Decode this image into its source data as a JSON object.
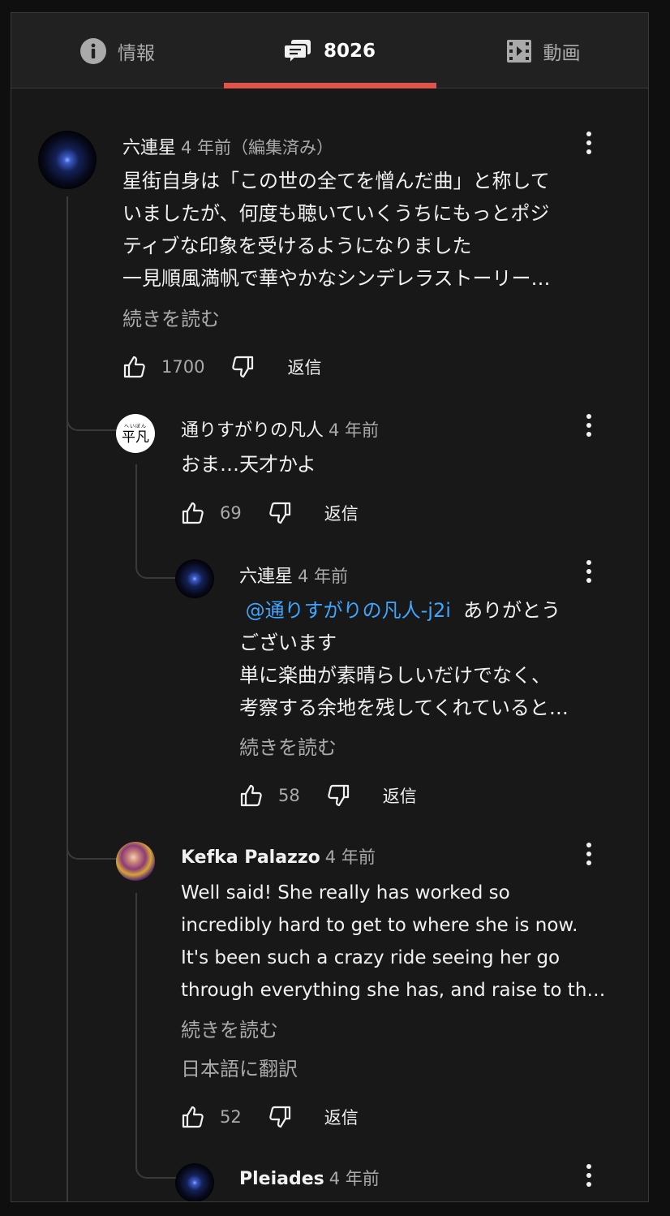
{
  "tabs": {
    "info_label": "情報",
    "comments_count": "8026",
    "video_label": "動画"
  },
  "comments": [
    {
      "author": "六連星",
      "time": "4 年前（編集済み）",
      "lines": [
        "星街自身は「この世の全てを憎んだ曲」と称して",
        "いましたが、何度も聴いていくうちにもっとポジ",
        "ティブな印象を受けるようになりました",
        "一見順風満帆で華やかなシンデレラストーリー…"
      ],
      "read_more": "続きを読む",
      "likes": "1700",
      "reply_label": "返信"
    },
    {
      "author": "通りすがりの凡人",
      "time": "4 年前",
      "avatar_text_small": "へいぼん",
      "avatar_text_big": "平凡",
      "lines": [
        "おま…天才かよ"
      ],
      "likes": "69",
      "reply_label": "返信"
    },
    {
      "author": "六連星",
      "time": "4 年前",
      "mention": "@通りすがりの凡人-j2i",
      "first_line_rest": "ありがとう",
      "lines": [
        "ございます",
        "単に楽曲が素晴らしいだけでなく、",
        "考察する余地を残してくれていると…"
      ],
      "read_more": "続きを読む",
      "likes": "58",
      "reply_label": "返信"
    },
    {
      "author": "Kefka Palazzo",
      "time": "4 年前",
      "lines": [
        "Well said! She really has worked so",
        "incredibly hard to get to where she is now.",
        "It's been such a crazy ride seeing her go",
        "through everything she has, and raise to th…"
      ],
      "read_more": "続きを読む",
      "translate": "日本語に翻訳",
      "likes": "52",
      "reply_label": "返信"
    },
    {
      "author": "Pleiades",
      "time": "4 年前"
    }
  ],
  "colors": {
    "background": "#181818",
    "tab_bar": "#212121",
    "tab_accent": "#e0544c",
    "mention": "#3ea6ff",
    "secondary_text": "#aaaaaa"
  },
  "icons": [
    "info-icon",
    "comment-icon",
    "video-icon",
    "thumb-up-icon",
    "thumb-down-icon",
    "more-vert-icon"
  ]
}
